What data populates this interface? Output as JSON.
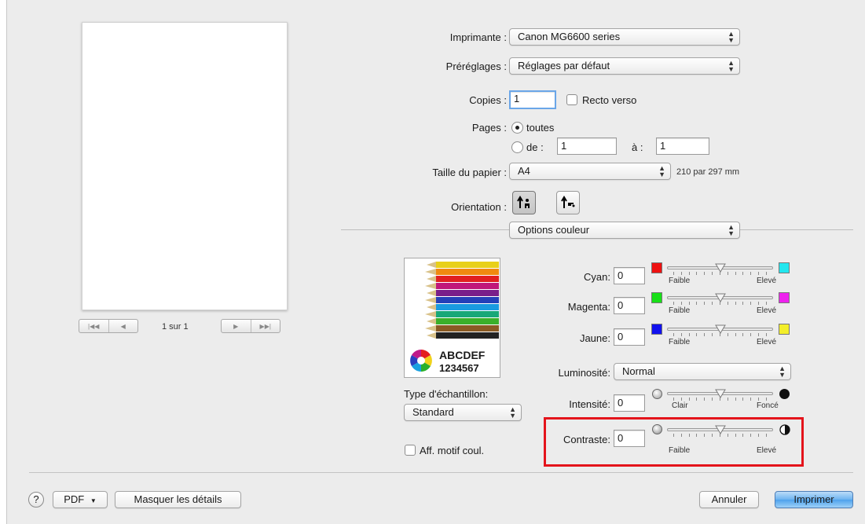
{
  "preview": {
    "page_indicator": "1 sur 1"
  },
  "printer": {
    "label": "Imprimante :",
    "value": "Canon MG6600 series"
  },
  "presets": {
    "label": "Préréglages :",
    "value": "Réglages par défaut"
  },
  "copies": {
    "label": "Copies :",
    "value": "1",
    "duplex_label": "Recto verso",
    "duplex_checked": false
  },
  "pages": {
    "label": "Pages :",
    "all_label": "toutes",
    "from_label": "de :",
    "from_value": "1",
    "to_label": "à :",
    "to_value": "1",
    "selected": "all"
  },
  "paper": {
    "label": "Taille du papier :",
    "value": "A4",
    "dimensions": "210 par 297 mm"
  },
  "orientation": {
    "label": "Orientation :",
    "selected": "portrait"
  },
  "section": {
    "value": "Options couleur"
  },
  "sample": {
    "text1": "ABCDEF",
    "text2": "1234567",
    "type_label": "Type d'échantillon:",
    "type_value": "Standard",
    "pattern_label": "Aff. motif coul.",
    "pattern_checked": false
  },
  "color": {
    "cyan": {
      "label": "Cyan:",
      "value": "0",
      "low": "Faible",
      "high": "Elevé",
      "low_color": "#ee1111",
      "high_color": "#22e6ee"
    },
    "magenta": {
      "label": "Magenta:",
      "value": "0",
      "low": "Faible",
      "high": "Elevé",
      "low_color": "#18e018",
      "high_color": "#ee22ee"
    },
    "yellow": {
      "label": "Jaune:",
      "value": "0",
      "low": "Faible",
      "high": "Elevé",
      "low_color": "#1111ee",
      "high_color": "#f3ee2a"
    },
    "brightness": {
      "label": "Luminosité:",
      "value": "Normal"
    },
    "intensity": {
      "label": "Intensité:",
      "value": "0",
      "low": "Clair",
      "high": "Foncé"
    },
    "contrast": {
      "label": "Contraste:",
      "value": "0",
      "low": "Faible",
      "high": "Elevé"
    }
  },
  "footer": {
    "help": "?",
    "pdf": "PDF",
    "hide_details": "Masquer les détails",
    "cancel": "Annuler",
    "print": "Imprimer"
  },
  "icons": [
    "help-icon",
    "pdf-menu-chevron-icon",
    "popup-arrows-icon",
    "slider-thumb-icon",
    "portrait-icon",
    "landscape-icon",
    "contrast-icon"
  ]
}
